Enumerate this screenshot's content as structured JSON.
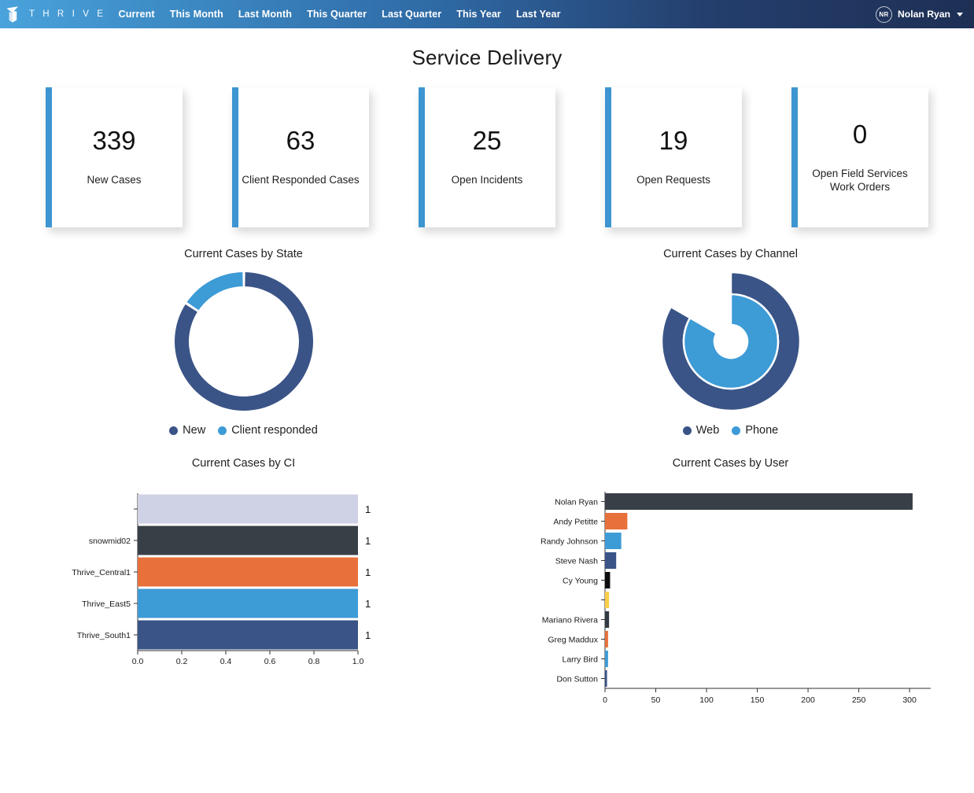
{
  "topbar": {
    "logo_icon": "thrive-logo-icon",
    "brand_word": "T H R I V E",
    "nav_items": [
      {
        "label": "Current"
      },
      {
        "label": "This Month"
      },
      {
        "label": "Last Month"
      },
      {
        "label": "This Quarter"
      },
      {
        "label": "Last Quarter"
      },
      {
        "label": "This Year"
      },
      {
        "label": "Last Year"
      }
    ],
    "user": {
      "initials": "NR",
      "name": "Nolan Ryan",
      "caret_icon": "chevron-down-icon"
    }
  },
  "page": {
    "title": "Service Delivery"
  },
  "kpis": [
    {
      "value": "339",
      "label": "New Cases"
    },
    {
      "value": "63",
      "label": "Client Responded Cases"
    },
    {
      "value": "25",
      "label": "Open Incidents"
    },
    {
      "value": "19",
      "label": "Open Requests"
    },
    {
      "value": "0",
      "label": "Open Field Services Work Orders"
    }
  ],
  "colors": {
    "accent_bar": "#3d95d1",
    "navy": "#3a5487",
    "light_blue": "#3d9bd6",
    "orange": "#e8703a",
    "charcoal": "#393f47",
    "lavender": "#cfd2e4",
    "yellow": "#f8cf46",
    "black": "#0d0d0d",
    "dark_slate": "#343a42"
  },
  "chart_data": [
    {
      "id": "cases-by-state",
      "type": "pie",
      "variant": "donut",
      "title": "Current Cases by State",
      "labels": [
        "New",
        "Client responded"
      ],
      "values": [
        339,
        63
      ],
      "percents": [
        84.3,
        15.7
      ],
      "colors": [
        "#3a5487",
        "#3d9bd6"
      ],
      "legend": "bottom",
      "start_angle_deg": 0,
      "direction": "clockwise"
    },
    {
      "id": "cases-by-channel",
      "type": "pie",
      "variant": "radial-nested",
      "title": "Current Cases by Channel",
      "labels": [
        "Web",
        "Phone"
      ],
      "colors": [
        "#3a5487",
        "#3d9bd6"
      ],
      "legend": "bottom",
      "series": [
        {
          "name": "Web",
          "sweep_deg": 300,
          "outer_radius": 72,
          "inner_radius": 44
        },
        {
          "name": "Phone",
          "sweep_deg": 300,
          "outer_radius": 44,
          "inner_radius": 5
        }
      ]
    },
    {
      "id": "cases-by-ci",
      "type": "bar",
      "orientation": "horizontal",
      "title": "Current Cases by CI",
      "categories": [
        "",
        "snowmid02",
        "Thrive_Central1",
        "Thrive_East5",
        "Thrive_South1"
      ],
      "values": [
        1,
        1,
        1,
        1,
        1
      ],
      "bar_labels": [
        "1",
        "1",
        "1",
        "1",
        "1"
      ],
      "bar_colors": [
        "#cfd2e4",
        "#393f47",
        "#e8703a",
        "#3d9bd6",
        "#3a5487"
      ],
      "xlabel": "",
      "ylabel": "",
      "xlim": [
        0,
        1
      ],
      "xticks": [
        "0.0",
        "0.2",
        "0.4",
        "0.6",
        "0.8",
        "1.0"
      ],
      "grid": false
    },
    {
      "id": "cases-by-user",
      "type": "bar",
      "orientation": "horizontal",
      "title": "Current Cases by User",
      "categories": [
        "Nolan Ryan",
        "Andy Petitte",
        "Randy Johnson",
        "Steve Nash",
        "Cy Young",
        "",
        "Mariano Rivera",
        "Greg Maddux",
        "Larry Bird",
        "Don Sutton"
      ],
      "values": [
        303,
        22,
        16,
        11,
        5,
        4,
        4,
        3,
        3,
        2
      ],
      "bar_colors": [
        "#393f47",
        "#e8703a",
        "#3d9bd6",
        "#3a5487",
        "#0d0d0d",
        "#f8cf46",
        "#343a42",
        "#e8703a",
        "#3d9bd6",
        "#3a5487"
      ],
      "xlabel": "",
      "ylabel": "",
      "xlim": [
        0,
        310
      ],
      "xticks": [
        "0",
        "50",
        "100",
        "150",
        "200",
        "250",
        "300"
      ],
      "xtick_values": [
        0,
        50,
        100,
        150,
        200,
        250,
        300
      ],
      "grid": false
    }
  ]
}
